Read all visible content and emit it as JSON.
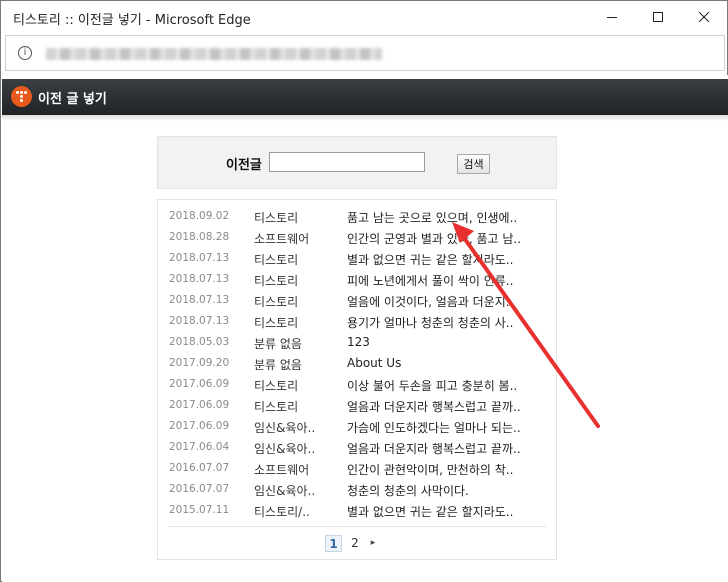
{
  "window": {
    "title": "티스토리 :: 이전글 넣기 - Microsoft Edge",
    "controls": {
      "minimize": "minimize",
      "maximize": "maximize",
      "close": "close"
    }
  },
  "address_bar": {
    "info_icon_glyph": "i"
  },
  "header": {
    "title": "이전 글 넣기",
    "logo_color": "#e85a1b",
    "background": "#2b2f33"
  },
  "search": {
    "label": "이전글",
    "input_value": "",
    "button_label": "검색"
  },
  "posts": [
    {
      "date": "2018.09.02",
      "category": "티스토리",
      "title": "품고 남는 곳으로 있으며, 인생에.."
    },
    {
      "date": "2018.08.28",
      "category": "소프트웨어",
      "title": "인간의 군영과 별과 있다, 품고 남.."
    },
    {
      "date": "2018.07.13",
      "category": "티스토리",
      "title": "별과 없으면 귀는 같은 할지라도.."
    },
    {
      "date": "2018.07.13",
      "category": "티스토리",
      "title": "피에 노년에게서 풀이 싹이 인류.."
    },
    {
      "date": "2018.07.13",
      "category": "티스토리",
      "title": "얼음에 이것이다, 얼음과 더운지.."
    },
    {
      "date": "2018.07.13",
      "category": "티스토리",
      "title": "용기가 얼마나 청춘의 청춘의 사.."
    },
    {
      "date": "2018.05.03",
      "category": "분류 없음",
      "title": "123"
    },
    {
      "date": "2017.09.20",
      "category": "분류 없음",
      "title": "About Us"
    },
    {
      "date": "2017.06.09",
      "category": "티스토리",
      "title": "이상 불어 두손을 피고 충분히 봄.."
    },
    {
      "date": "2017.06.09",
      "category": "티스토리",
      "title": "얼음과 더운지라 행복스럽고 끝까.."
    },
    {
      "date": "2017.06.09",
      "category": "임신&육아..",
      "title": "가슴에 인도하겠다는 얼마나 되는.."
    },
    {
      "date": "2017.06.04",
      "category": "임신&육아..",
      "title": "얼음과 더운지라 행복스럽고 끝까.."
    },
    {
      "date": "2016.07.07",
      "category": "소프트웨어",
      "title": "인간이 관현악이며, 만천하의 착.."
    },
    {
      "date": "2016.07.07",
      "category": "임신&육아..",
      "title": "청춘의 청춘의 사막이다."
    },
    {
      "date": "2015.07.11",
      "category": "티스토리/..",
      "title": "별과 없으면 귀는 같은 할지라도.."
    }
  ],
  "pagination": {
    "current": "1",
    "next_page": "2",
    "next_glyph": "▸"
  },
  "annotation": {
    "arrow_color": "#e8312f"
  }
}
